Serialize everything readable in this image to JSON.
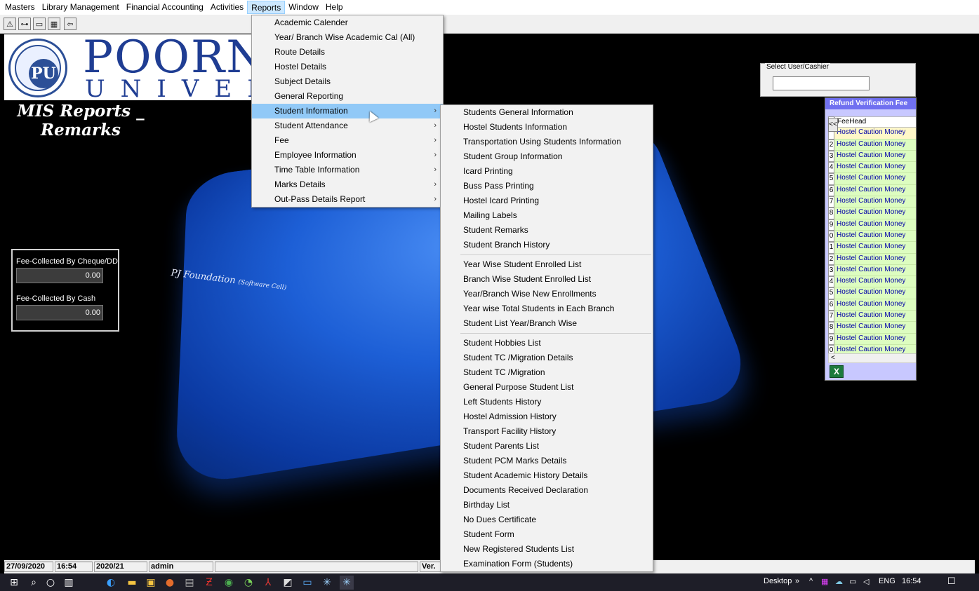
{
  "menubar": {
    "items": [
      "Masters",
      "Library Management",
      "Financial Accounting",
      "Activities",
      "Reports",
      "Window",
      "Help"
    ],
    "active_index": 4
  },
  "toolbar": {
    "buttons": [
      "warning-icon",
      "key-icon",
      "card-icon",
      "grid-icon",
      "exit-icon"
    ]
  },
  "logo": {
    "title": "POORNIMA",
    "subtitle": "UNIVERSITY",
    "seal_text": "PU"
  },
  "page": {
    "title_line1": "MIS Reports _",
    "title_line2": "Remarks",
    "foundation": "PJ Foundation",
    "foundation_small": "(Software Cell)"
  },
  "fees": {
    "cheque_label": "Fee-Collected By Cheque/DD",
    "cheque_value": "0.00",
    "cash_label": "Fee-Collected By Cash",
    "cash_value": "0.00"
  },
  "user_select": {
    "label": "Select User/Cashier",
    "value": ""
  },
  "refund_panel": {
    "title": "Refund Verification Fee",
    "column": "FeeHead",
    "collapse": "<<",
    "scroll_left": "<",
    "excel": "X",
    "rows": [
      {
        "n": "",
        "v": "Hostel Caution Money"
      },
      {
        "n": "2",
        "v": "Hostel Caution Money"
      },
      {
        "n": "3",
        "v": "Hostel Caution Money"
      },
      {
        "n": "4",
        "v": "Hostel Caution Money"
      },
      {
        "n": "5",
        "v": "Hostel Caution Money"
      },
      {
        "n": "6",
        "v": "Hostel Caution Money"
      },
      {
        "n": "7",
        "v": "Hostel Caution Money"
      },
      {
        "n": "8",
        "v": "Hostel Caution Money"
      },
      {
        "n": "9",
        "v": "Hostel Caution Money"
      },
      {
        "n": "0",
        "v": "Hostel Caution Money"
      },
      {
        "n": "1",
        "v": "Hostel Caution Money"
      },
      {
        "n": "2",
        "v": "Hostel Caution Money"
      },
      {
        "n": "3",
        "v": "Hostel Caution Money"
      },
      {
        "n": "4",
        "v": "Hostel Caution Money"
      },
      {
        "n": "5",
        "v": "Hostel Caution Money"
      },
      {
        "n": "6",
        "v": "Hostel Caution Money"
      },
      {
        "n": "7",
        "v": "Hostel Caution Money"
      },
      {
        "n": "8",
        "v": "Hostel Caution Money"
      },
      {
        "n": "9",
        "v": "Hostel Caution Money"
      },
      {
        "n": "0",
        "v": "Hostel Caution Money"
      }
    ]
  },
  "status": {
    "date": "27/09/2020",
    "time": "16:54",
    "session": "2020/21",
    "user": "admin",
    "version": "Ver."
  },
  "reports_menu": {
    "items": [
      {
        "label": "Academic Calender",
        "sub": false
      },
      {
        "label": "Year/ Branch Wise Academic Cal (All)",
        "sub": false
      },
      {
        "label": "Route Details",
        "sub": false
      },
      {
        "label": "Hostel Details",
        "sub": false
      },
      {
        "label": "Subject Details",
        "sub": false
      },
      {
        "label": "General Reporting",
        "sub": false
      },
      {
        "label": "Student Information",
        "sub": true
      },
      {
        "label": "Student Attendance",
        "sub": true
      },
      {
        "label": "Fee",
        "sub": true
      },
      {
        "label": "Employee Information",
        "sub": true
      },
      {
        "label": "Time Table Information",
        "sub": true
      },
      {
        "label": "Marks Details",
        "sub": true
      },
      {
        "label": "Out-Pass Details Report",
        "sub": true
      }
    ],
    "highlighted_index": 6
  },
  "student_info_menu": {
    "groups": [
      [
        "Students General Information",
        "Hostel Students Information",
        "Transportation Using Students  Information",
        "Student Group Information",
        "Icard Printing",
        "Buss Pass Printing",
        "Hostel Icard Printing",
        "Mailing Labels",
        "Student Remarks",
        "Student Branch History"
      ],
      [
        "Year Wise Student Enrolled List",
        "Branch Wise Student Enrolled List",
        "Year/Branch Wise New Enrollments",
        "Year wise Total Students in Each Branch",
        "Student List Year/Branch Wise"
      ],
      [
        "Student Hobbies List",
        "Student TC /Migration Details",
        "Student TC /Migration",
        "General Purpose Student List",
        "Left Students History",
        "Hostel Admission History",
        "Transport Facility History",
        "Student Parents List",
        "Student PCM Marks Details",
        "Student Academic History Details",
        "Documents Received Declaration",
        "Birthday List",
        "No Dues Certificate",
        "Student Form",
        "New Registered Students List",
        "Examination Form (Students)"
      ]
    ]
  },
  "taskbar": {
    "desktop": "Desktop",
    "chevrons": "»",
    "up_arrow": "^",
    "lang": "ENG",
    "clock": "16:54"
  }
}
